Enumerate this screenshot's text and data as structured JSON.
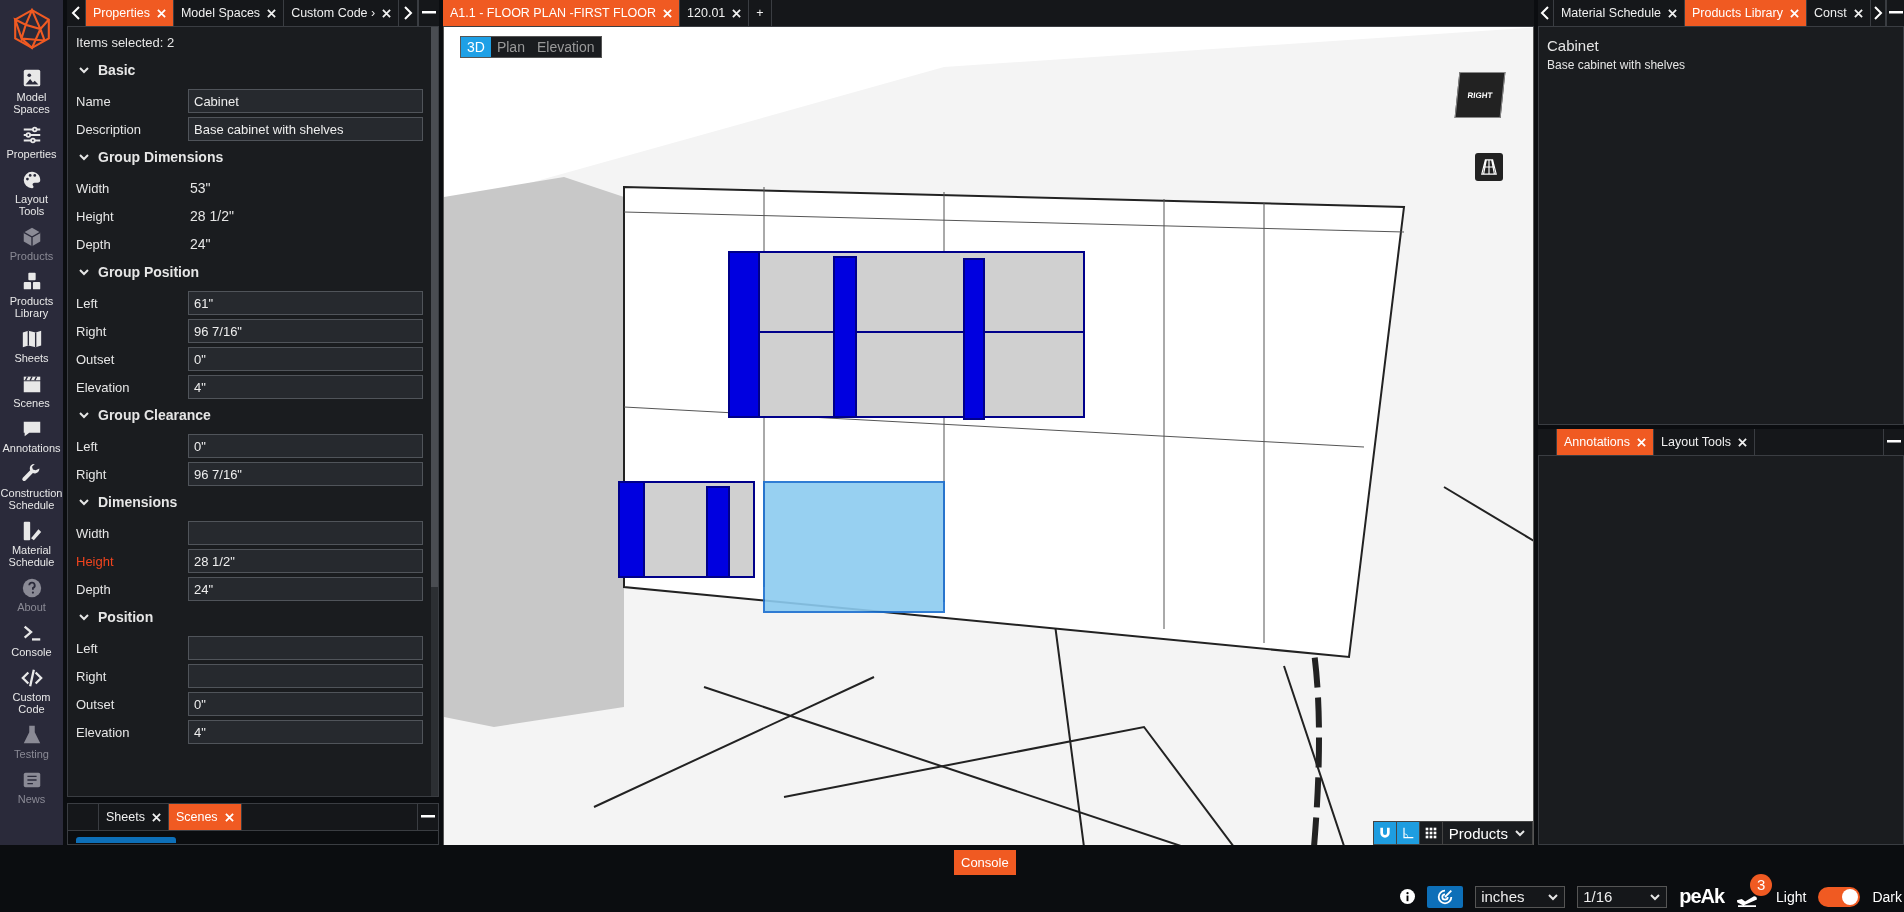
{
  "sidebar": {
    "items": [
      {
        "label": "Model Spaces",
        "kind": "image",
        "disabled": false
      },
      {
        "label": "Properties",
        "kind": "sliders",
        "disabled": false
      },
      {
        "label": "Layout Tools",
        "kind": "palette",
        "disabled": false
      },
      {
        "label": "Products",
        "kind": "cube",
        "disabled": true
      },
      {
        "label": "Products Library",
        "kind": "cubes",
        "disabled": false
      },
      {
        "label": "Sheets",
        "kind": "map",
        "disabled": false
      },
      {
        "label": "Scenes",
        "kind": "clapper",
        "disabled": false
      },
      {
        "label": "Annotations",
        "kind": "comment",
        "disabled": false
      },
      {
        "label": "Construction Schedule",
        "kind": "wrench",
        "disabled": false
      },
      {
        "label": "Material Schedule",
        "kind": "swatch",
        "disabled": false
      },
      {
        "label": "About",
        "kind": "help",
        "disabled": true
      },
      {
        "label": "Console",
        "kind": "terminal",
        "disabled": false
      },
      {
        "label": "Custom Code",
        "kind": "code",
        "disabled": false
      },
      {
        "label": "Testing",
        "kind": "flask",
        "disabled": true
      },
      {
        "label": "News",
        "kind": "news",
        "disabled": true
      }
    ]
  },
  "left_panel": {
    "tabs": [
      {
        "label": "Properties",
        "selected": true
      },
      {
        "label": "Model Spaces",
        "selected": false
      },
      {
        "label": "Custom Code ›",
        "selected": false
      }
    ],
    "items_selected": "Items selected: 2",
    "sections": [
      {
        "title": "Basic",
        "expanded": true,
        "rows": [
          {
            "label": "Name",
            "kind": "field",
            "value": "Cabinet",
            "highlighted": false
          },
          {
            "label": "Description",
            "kind": "field",
            "value": "Base cabinet with shelves",
            "highlighted": false
          }
        ]
      },
      {
        "title": "Group Dimensions",
        "expanded": true,
        "rows": [
          {
            "label": "Width",
            "kind": "text",
            "value": "53\"",
            "highlighted": false
          },
          {
            "label": "Height",
            "kind": "text",
            "value": "28 1/2\"",
            "highlighted": false
          },
          {
            "label": "Depth",
            "kind": "text",
            "value": "24\"",
            "highlighted": false
          }
        ]
      },
      {
        "title": "Group Position",
        "expanded": true,
        "rows": [
          {
            "label": "Left",
            "kind": "field",
            "value": "61\"",
            "highlighted": false
          },
          {
            "label": "Right",
            "kind": "field",
            "value": "96 7/16\"",
            "highlighted": false
          },
          {
            "label": "Outset",
            "kind": "field",
            "value": "0\"",
            "highlighted": false
          },
          {
            "label": "Elevation",
            "kind": "field",
            "value": "4\"",
            "highlighted": false
          }
        ]
      },
      {
        "title": "Group Clearance",
        "expanded": true,
        "rows": [
          {
            "label": "Left",
            "kind": "field",
            "value": "0\"",
            "highlighted": false
          },
          {
            "label": "Right",
            "kind": "field",
            "value": "96 7/16\"",
            "highlighted": false
          }
        ]
      },
      {
        "title": "Dimensions",
        "expanded": true,
        "rows": [
          {
            "label": "Width",
            "kind": "field",
            "highlighted": false
          },
          {
            "label": "Height",
            "kind": "field",
            "value": "28 1/2\"",
            "highlighted": true
          },
          {
            "label": "Depth",
            "kind": "field",
            "value": "24\"",
            "highlighted": false
          }
        ]
      },
      {
        "title": "Position",
        "expanded": true,
        "rows": [
          {
            "label": "Left",
            "kind": "field",
            "highlighted": false
          },
          {
            "label": "Right",
            "kind": "field",
            "highlighted": false
          },
          {
            "label": "Outset",
            "kind": "field",
            "value": "0\"",
            "highlighted": false
          },
          {
            "label": "Elevation",
            "kind": "field",
            "value": "4\"",
            "highlighted": false
          }
        ]
      }
    ],
    "bottom_tabs": [
      {
        "label": "Sheets",
        "selected": false
      },
      {
        "label": "Scenes",
        "selected": true
      }
    ]
  },
  "center": {
    "tabs": [
      {
        "label": "A1.1 - FLOOR PLAN -FIRST FLOOR",
        "selected": true
      },
      {
        "label": "120.01",
        "selected": false
      }
    ],
    "add_tab": "+",
    "view_modes": [
      {
        "label": "3D",
        "selected": true
      },
      {
        "label": "Plan",
        "selected": false
      },
      {
        "label": "Elevation",
        "selected": false
      }
    ],
    "view_cube": "RIGHT",
    "tools": [
      {
        "kind": "magnet",
        "on": true
      },
      {
        "kind": "angle",
        "on": true
      },
      {
        "kind": "grid",
        "on": false
      }
    ],
    "products_dropdown": "Products"
  },
  "right_panel": {
    "tabs": [
      {
        "label": "Material Schedule",
        "selected": false
      },
      {
        "label": "Products Library",
        "selected": true
      },
      {
        "label": "Const",
        "selected": false
      }
    ],
    "title": "Cabinet",
    "description": "Base cabinet with shelves",
    "bottom_tabs": [
      {
        "label": "Annotations",
        "selected": true
      },
      {
        "label": "Layout Tools",
        "selected": false
      }
    ]
  },
  "bottom_bar": {
    "console_button": "Console",
    "units": "inches",
    "precision": "1/16",
    "logo": "peAk",
    "notification_count": "3",
    "theme_toggle": {
      "light_label": "Light",
      "dark_label": "Dark",
      "on": true
    }
  }
}
